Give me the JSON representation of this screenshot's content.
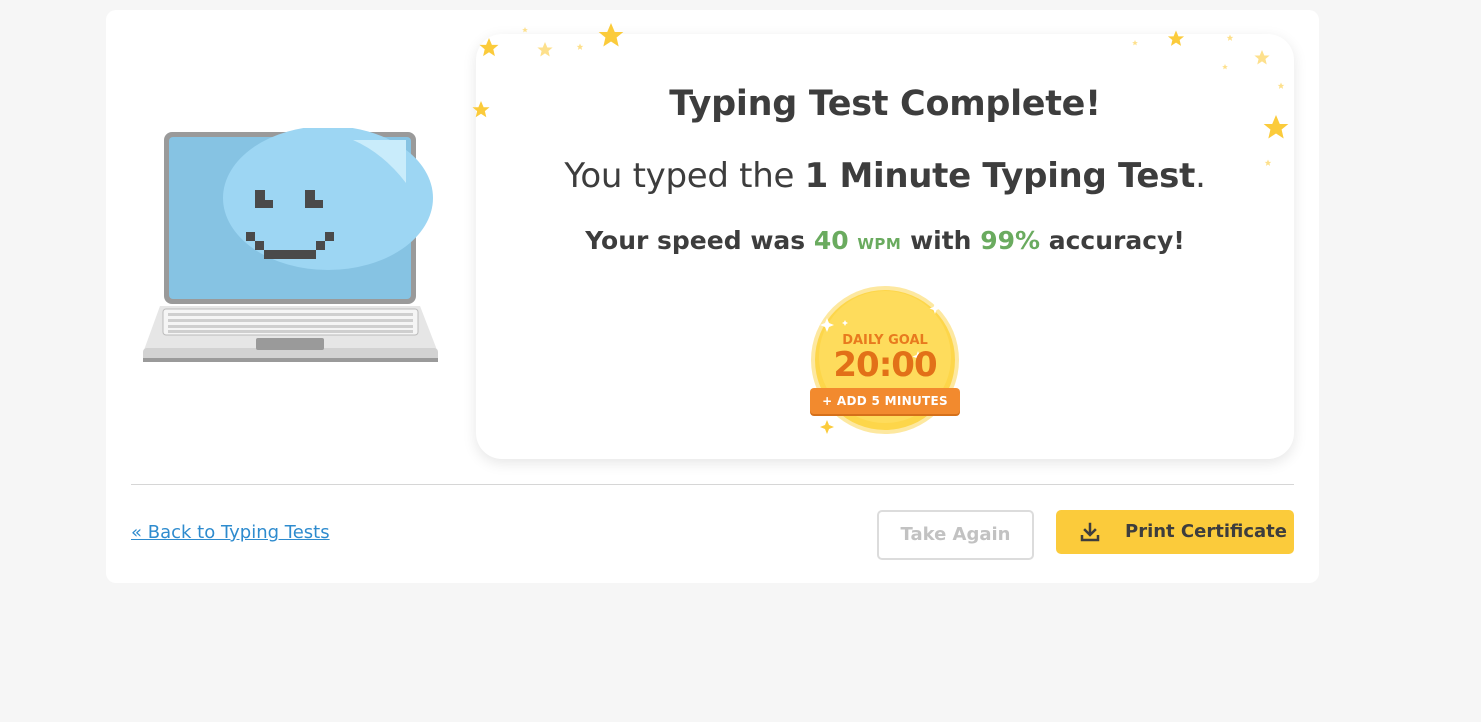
{
  "result": {
    "title": "Typing Test Complete!",
    "subtitle_prefix": "You typed the ",
    "test_name": "1 Minute Typing Test",
    "subtitle_suffix": ".",
    "speed_prefix": "Your speed was ",
    "wpm_value": "40",
    "wpm_unit": "WPM",
    "speed_middle": " with ",
    "accuracy_value": "99%",
    "speed_suffix": " accuracy!"
  },
  "daily_goal": {
    "label": "DAILY GOAL",
    "time": "20:00",
    "add_button": "+ ADD 5 MINUTES"
  },
  "footer": {
    "back_link": "« Back to Typing Tests",
    "take_again": "Take Again",
    "print_certificate": "Print Certificate"
  },
  "colors": {
    "accent_green": "#6aab5f",
    "link_blue": "#2e8bce",
    "print_yellow": "#fbcb3b",
    "goal_orange": "#f28a2e"
  },
  "icons": {
    "mascot": "laptop-smiley-icon",
    "download": "download-icon",
    "stars": "star-icon"
  }
}
